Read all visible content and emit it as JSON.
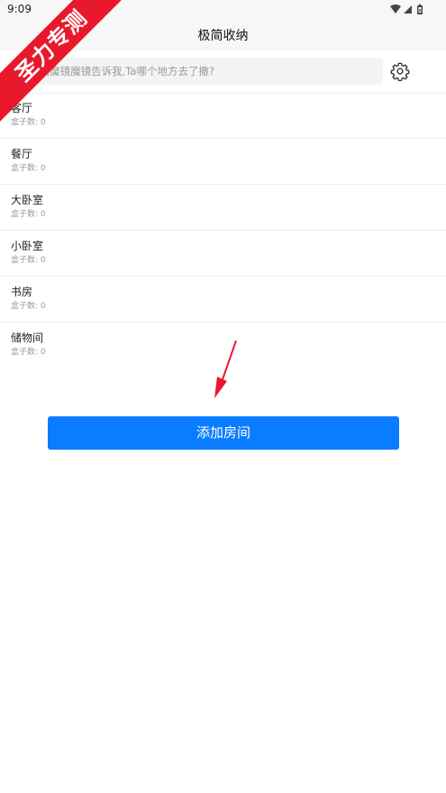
{
  "status_bar": {
    "time": "9:09"
  },
  "app_bar": {
    "title": "极简收纳"
  },
  "search": {
    "placeholder": "哎,魔镜魔镜告诉我,Ta哪个地方去了撒?"
  },
  "rooms": [
    {
      "name": "客厅",
      "count_label": "盒子数: 0"
    },
    {
      "name": "餐厅",
      "count_label": "盒子数: 0"
    },
    {
      "name": "大卧室",
      "count_label": "盒子数: 0"
    },
    {
      "name": "小卧室",
      "count_label": "盒子数: 0"
    },
    {
      "name": "书房",
      "count_label": "盒子数: 0"
    },
    {
      "name": "储物间",
      "count_label": "盒子数: 0"
    }
  ],
  "add_room_button": {
    "label": "添加房间"
  },
  "watermark": {
    "text": "圣力专测"
  },
  "colors": {
    "accent": "#0a7cff",
    "watermark": "#e8192c",
    "annotation_arrow": "#e8192c"
  },
  "icons": {
    "settings": "gear-icon",
    "wifi": "wifi-icon",
    "signal": "signal-icon",
    "battery": "battery-icon"
  }
}
